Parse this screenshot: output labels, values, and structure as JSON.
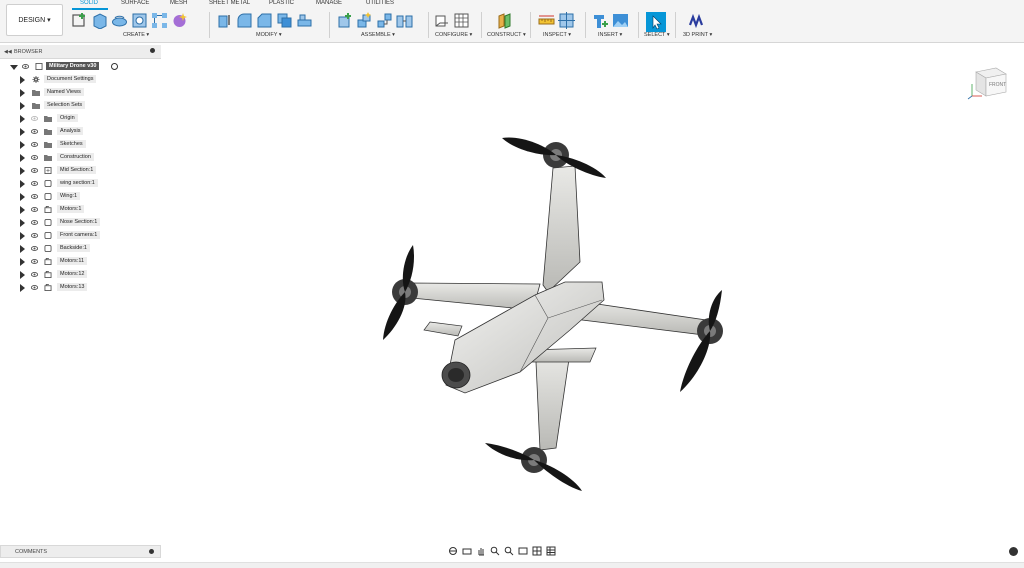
{
  "toolbar": {
    "design_label": "DESIGN ▾",
    "tabs": [
      "SOLID",
      "SURFACE",
      "MESH",
      "SHEET METAL",
      "PLASTIC",
      "MANAGE",
      "UTILITIES"
    ],
    "active_tab": "SOLID",
    "groups": [
      "CREATE ▾",
      "MODIFY ▾",
      "ASSEMBLE ▾",
      "CONFIGURE ▾",
      "CONSTRUCT ▾",
      "INSPECT ▾",
      "INSERT ▾",
      "SELECT ▾",
      "3D PRINT ▾"
    ],
    "accent": "#0696d7"
  },
  "browser": {
    "title": "BROWSER",
    "root": "Military Drone v30",
    "items": [
      "Document Settings",
      "Named Views",
      "Selection Sets",
      "Origin",
      "Analysis",
      "Sketches",
      "Construction",
      "Mid Section:1",
      "wing section:1",
      "Wing:1",
      "Motors:1",
      "Nose Section:1",
      "Front camera:1",
      "Backside:1",
      "Motors:11",
      "Motors:12",
      "Motors:13"
    ]
  },
  "viewcube": {
    "face": "FRONT"
  },
  "comments": {
    "title": "COMMENTS"
  }
}
